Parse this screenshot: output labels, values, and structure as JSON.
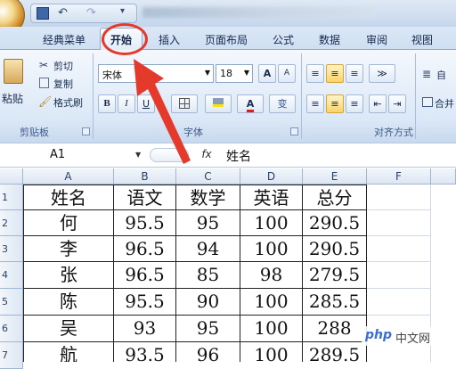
{
  "title_bar": {
    "quick_access": [
      "save-icon",
      "undo-icon",
      "redo-icon"
    ]
  },
  "tabs": [
    "经典菜单",
    "开始",
    "插入",
    "页面布局",
    "公式",
    "数据",
    "审阅",
    "视图"
  ],
  "active_tab_index": 1,
  "clipboard": {
    "paste": "粘贴",
    "cut": "剪切",
    "copy": "复制",
    "format_painter": "格式刷",
    "group": "剪贴板"
  },
  "font": {
    "name": "宋体",
    "size": "18",
    "group": "字体",
    "grow": "A",
    "shrink": "A",
    "wen": "变"
  },
  "alignment": {
    "wrap": "自",
    "merge": "合并",
    "group": "对齐方式"
  },
  "formula_bar": {
    "name_box": "A1",
    "fx": "fx",
    "value": "姓名"
  },
  "columns": [
    "A",
    "B",
    "C",
    "D",
    "E",
    "F"
  ],
  "rows": [
    "1",
    "2",
    "3",
    "4",
    "5",
    "6",
    "7"
  ],
  "table": {
    "headers": [
      "姓名",
      "语文",
      "数学",
      "英语",
      "总分"
    ],
    "rows": [
      [
        "何",
        "95.5",
        "95",
        "100",
        "290.5"
      ],
      [
        "李",
        "96.5",
        "94",
        "100",
        "290.5"
      ],
      [
        "张",
        "96.5",
        "85",
        "98",
        "279.5"
      ],
      [
        "陈",
        "95.5",
        "90",
        "100",
        "285.5"
      ],
      [
        "吴",
        "93",
        "95",
        "100",
        "288"
      ],
      [
        "航",
        "93.5",
        "96",
        "100",
        "289.5"
      ]
    ]
  },
  "watermark": {
    "text": "php",
    "suffix": "中文网"
  },
  "colors": {
    "annotation": "#e43a2c",
    "ribbon_bg": "#dbe8f7"
  }
}
